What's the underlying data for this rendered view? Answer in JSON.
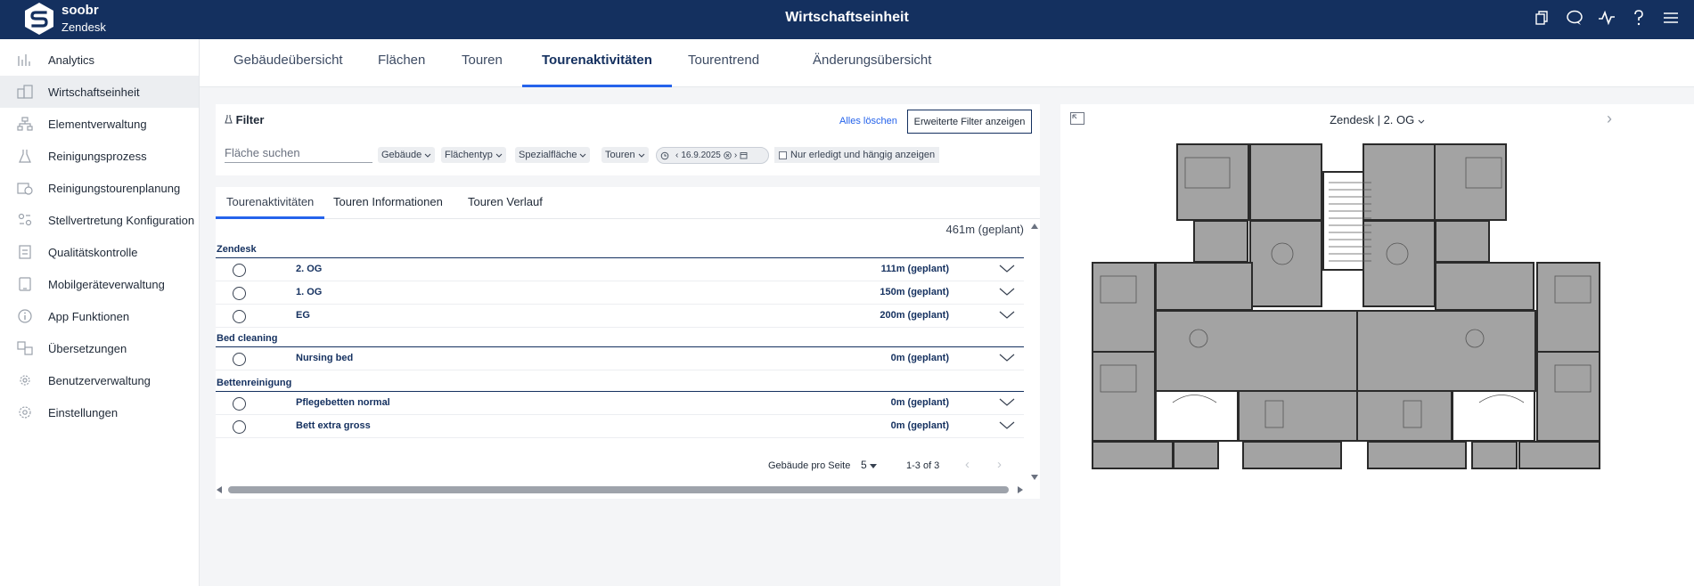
{
  "header": {
    "brand_name": "soobr",
    "brand_sub": "Zendesk",
    "title": "Wirtschaftseinheit",
    "icons": [
      "copy-icon",
      "chat-icon",
      "activity-icon",
      "help-icon",
      "menu-icon"
    ]
  },
  "sidebar": {
    "items": [
      {
        "label": "Analytics",
        "icon": "chart-icon"
      },
      {
        "label": "Wirtschaftseinheit",
        "icon": "building-icon"
      },
      {
        "label": "Elementverwaltung",
        "icon": "hierarchy-icon"
      },
      {
        "label": "Reinigungsprozess",
        "icon": "flask-icon"
      },
      {
        "label": "Reinigungstourenplanung",
        "icon": "calendar-clock-icon"
      },
      {
        "label": "Stellvertretung Konfiguration",
        "icon": "swap-users-icon"
      },
      {
        "label": "Qualitätskontrolle",
        "icon": "checklist-icon"
      },
      {
        "label": "Mobilgeräteverwaltung",
        "icon": "tablet-icon"
      },
      {
        "label": "App Funktionen",
        "icon": "info-icon"
      },
      {
        "label": "Übersetzungen",
        "icon": "translate-icon"
      },
      {
        "label": "Benutzerverwaltung",
        "icon": "user-gear-icon"
      },
      {
        "label": "Einstellungen",
        "icon": "gear-icon"
      }
    ]
  },
  "tabs": [
    {
      "label": "Gebäudeübersicht"
    },
    {
      "label": "Flächen"
    },
    {
      "label": "Touren"
    },
    {
      "label": "Tourenaktivitäten"
    },
    {
      "label": "Tourentrend"
    },
    {
      "label": "Änderungsübersicht"
    }
  ],
  "filter": {
    "title": "Filter",
    "clear_label": "Alles löschen",
    "advanced_label": "Erweiterte Filter anzeigen",
    "search_placeholder": "Fläche suchen",
    "chips": [
      "Gebäude",
      "Flächentyp",
      "Spezialfläche",
      "Touren"
    ],
    "date": "16.9.2025",
    "checkbox_label": "Nur erledigt und hängig anzeigen"
  },
  "subtabs": [
    "Tourenaktivitäten",
    "Touren Informationen",
    "Touren Verlauf"
  ],
  "list": {
    "total": "461m (geplant)",
    "groups": [
      {
        "name": "Zendesk",
        "rows": [
          {
            "name": "2. OG",
            "value": "111m (geplant)"
          },
          {
            "name": "1. OG",
            "value": "150m (geplant)"
          },
          {
            "name": "EG",
            "value": "200m (geplant)"
          }
        ]
      },
      {
        "name": "Bed cleaning",
        "rows": [
          {
            "name": "Nursing bed",
            "value": "0m (geplant)"
          }
        ]
      },
      {
        "name": "Bettenreinigung",
        "rows": [
          {
            "name": "Pflegebetten normal",
            "value": "0m (geplant)"
          },
          {
            "name": "Bett extra gross",
            "value": "0m (geplant)"
          }
        ]
      }
    ]
  },
  "pager": {
    "per_page_label": "Gebäude pro Seite",
    "per_page_value": "5",
    "range": "1-3 of 3"
  },
  "plan": {
    "building": "Zendesk",
    "floor": "2. OG"
  }
}
